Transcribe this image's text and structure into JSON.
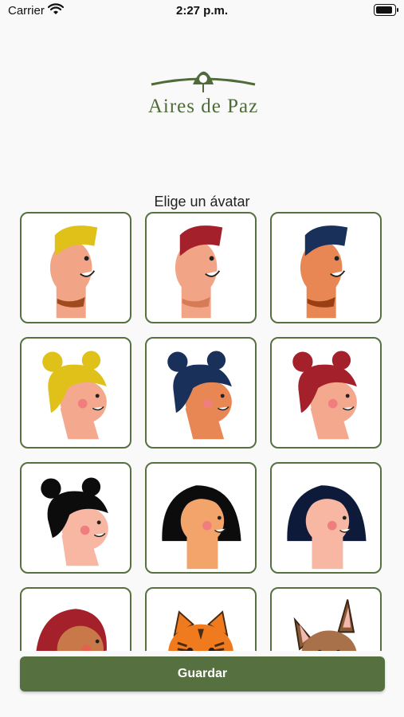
{
  "status_bar": {
    "carrier": "Carrier",
    "time": "2:27 p.m."
  },
  "logo": {
    "text": "Aires de Paz",
    "icon": "leaf-flower-icon"
  },
  "header": {
    "title": "Elige un ávatar"
  },
  "avatars": [
    {
      "icon": "boy-avatar-yellow-hair-icon"
    },
    {
      "icon": "boy-avatar-red-hair-icon"
    },
    {
      "icon": "boy-avatar-blue-hair-icon"
    },
    {
      "icon": "girl-buns-avatar-yellow-hair-icon"
    },
    {
      "icon": "girl-buns-avatar-blue-hair-icon"
    },
    {
      "icon": "girl-buns-avatar-red-hair-icon"
    },
    {
      "icon": "girl-buns-avatar-black-hair-icon"
    },
    {
      "icon": "girl-bob-avatar-black-hair-icon"
    },
    {
      "icon": "girl-bob-avatar-navy-hair-icon"
    },
    {
      "icon": "girl-avatar-red-hair-icon"
    },
    {
      "icon": "tiger-cat-avatar-icon"
    },
    {
      "icon": "dog-avatar-icon"
    }
  ],
  "actions": {
    "save_label": "Guardar"
  },
  "colors": {
    "accent": "#56713f",
    "card_border": "#56713f",
    "background": "#f9f9f9"
  }
}
